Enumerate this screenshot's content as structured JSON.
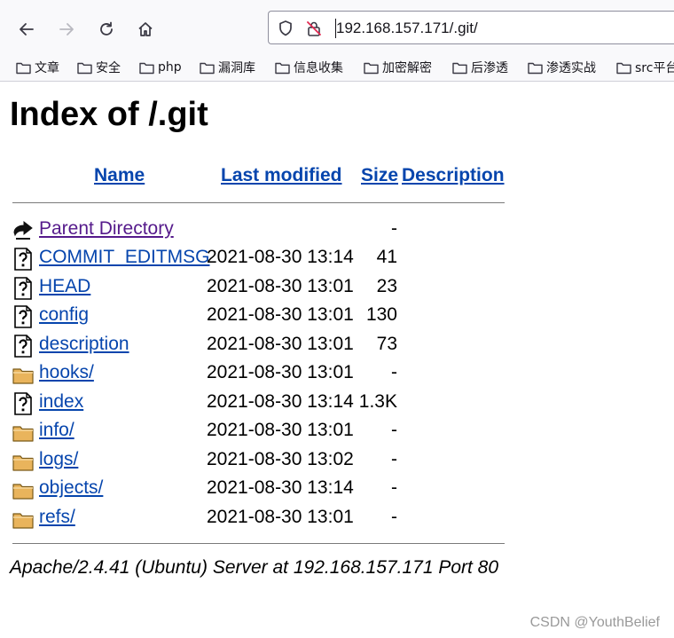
{
  "browser": {
    "url": "192.168.157.171/.git/",
    "bookmarks": [
      "文章",
      "安全",
      "php",
      "漏洞库",
      "信息收集",
      "加密解密",
      "后渗透",
      "渗透实战",
      "src平台"
    ]
  },
  "page": {
    "title": "Index of /.git",
    "columns": {
      "name": "Name",
      "last_modified": "Last modified",
      "size": "Size",
      "description": "Description"
    },
    "parent": {
      "label": "Parent Directory",
      "size": "-"
    },
    "entries": [
      {
        "name": "COMMIT_EDITMSG",
        "date": "2021-08-30 13:14",
        "size": "41",
        "icon": "unknown-file-icon"
      },
      {
        "name": "HEAD",
        "date": "2021-08-30 13:01",
        "size": "23",
        "icon": "unknown-file-icon"
      },
      {
        "name": "config",
        "date": "2021-08-30 13:01",
        "size": "130",
        "icon": "unknown-file-icon"
      },
      {
        "name": "description",
        "date": "2021-08-30 13:01",
        "size": "73",
        "icon": "unknown-file-icon"
      },
      {
        "name": "hooks/",
        "date": "2021-08-30 13:01",
        "size": "-",
        "icon": "folder-icon"
      },
      {
        "name": "index",
        "date": "2021-08-30 13:14",
        "size": "1.3K",
        "icon": "unknown-file-icon"
      },
      {
        "name": "info/",
        "date": "2021-08-30 13:01",
        "size": "-",
        "icon": "folder-icon"
      },
      {
        "name": "logs/",
        "date": "2021-08-30 13:02",
        "size": "-",
        "icon": "folder-icon"
      },
      {
        "name": "objects/",
        "date": "2021-08-30 13:14",
        "size": "-",
        "icon": "folder-icon"
      },
      {
        "name": "refs/",
        "date": "2021-08-30 13:01",
        "size": "-",
        "icon": "folder-icon"
      }
    ],
    "address": "Apache/2.4.41 (Ubuntu) Server at 192.168.157.171 Port 80"
  },
  "watermark": "CSDN @YouthBelief"
}
